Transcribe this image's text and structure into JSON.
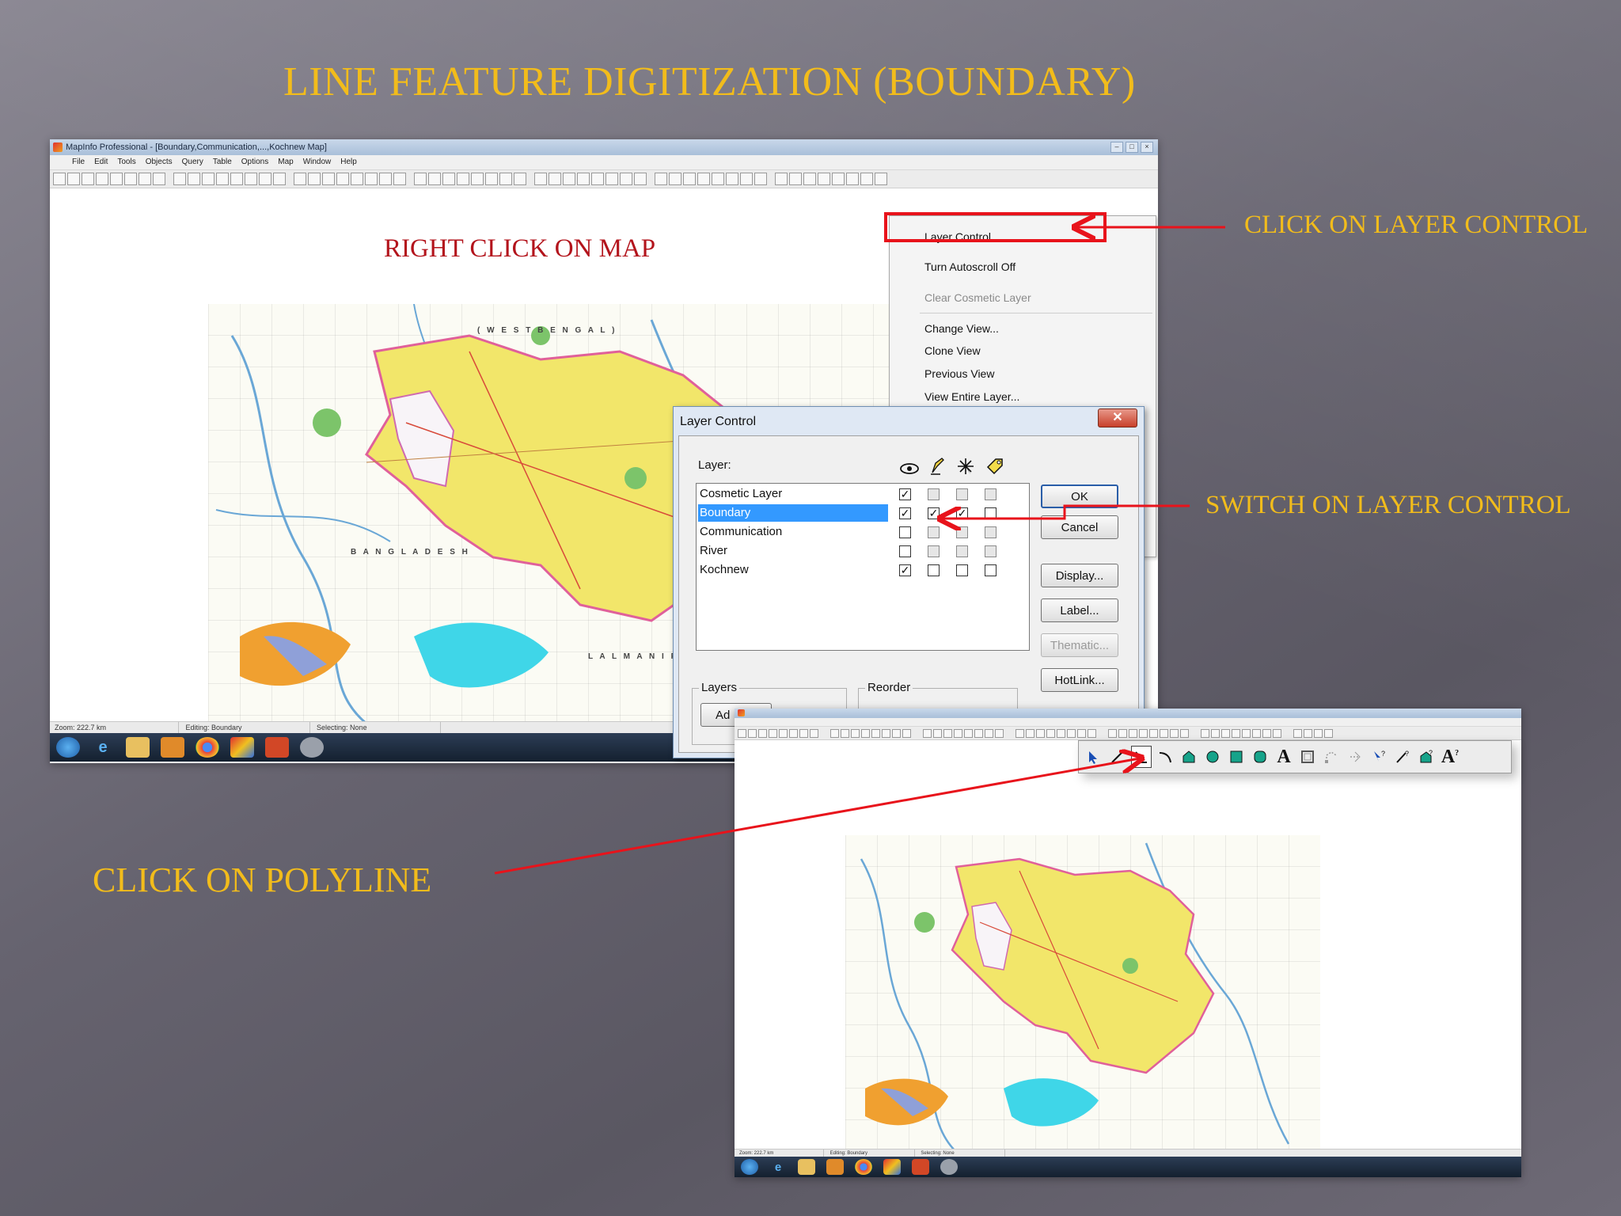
{
  "slide": {
    "title": "LINE FEATURE DIGITIZATION (BOUNDARY)"
  },
  "callouts": {
    "right_click": "RIGHT CLICK ON MAP",
    "click_layer_control": "CLICK ON LAYER CONTROL",
    "switch_layer_control": "SWITCH ON LAYER CONTROL",
    "click_polyline": "CLICK ON POLYLINE"
  },
  "colors": {
    "callout_text": "#f2bc1b",
    "map_note_text": "#b3141c",
    "annotation_red": "#e8131b",
    "selection_blue": "#3399ff"
  },
  "app_window": {
    "title": "MapInfo Professional - [Boundary,Communication,...,Kochnew Map]",
    "menus": [
      "File",
      "Edit",
      "Tools",
      "Objects",
      "Query",
      "Table",
      "Options",
      "Map",
      "Window",
      "Help"
    ],
    "status": {
      "zoom": "Zoom: 222.7 km",
      "editing": "Editing: Boundary",
      "selecting": "Selecting: None"
    },
    "map_labels": {
      "west_bengal": "( W E S T  B E N G A L )",
      "bangladesh": "B A N G L A D E S H",
      "lalmanirhat": "L A L M A N I R H A T"
    }
  },
  "context_menu": {
    "items": [
      {
        "label": "Layer Control...",
        "enabled": true
      },
      {
        "label": "Turn Autoscroll Off",
        "enabled": true
      },
      {
        "label": "Clear Cosmetic Layer",
        "enabled": false
      },
      {
        "label": "Change View...",
        "enabled": true
      },
      {
        "label": "Clone View",
        "enabled": true
      },
      {
        "label": "Previous View",
        "enabled": true
      },
      {
        "label": "View Entire Layer...",
        "enabled": true
      }
    ]
  },
  "layer_dialog": {
    "title": "Layer Control",
    "close_glyph": "✕",
    "layer_label": "Layer:",
    "layers": [
      {
        "name": "Cosmetic Layer",
        "visible": true,
        "editable": false,
        "selectable": false,
        "autolabel": false,
        "selected": false
      },
      {
        "name": "Boundary",
        "visible": true,
        "editable": true,
        "selectable": true,
        "autolabel": false,
        "selected": true
      },
      {
        "name": "Communication",
        "visible": false,
        "editable": false,
        "selectable": false,
        "autolabel": false,
        "selected": false
      },
      {
        "name": "River",
        "visible": false,
        "editable": false,
        "selectable": false,
        "autolabel": false,
        "selected": false
      },
      {
        "name": "Kochnew",
        "visible": true,
        "editable": false,
        "selectable": false,
        "autolabel": false,
        "selected": false
      }
    ],
    "buttons": {
      "ok": "OK",
      "cancel": "Cancel",
      "display": "Display...",
      "label": "Label...",
      "thematic": "Thematic...",
      "hotlink": "HotLink..."
    },
    "groups": {
      "layers": "Layers",
      "reorder": "Reorder",
      "add_partial": "Ad"
    }
  },
  "drawing_toolbar": {
    "tools": [
      "select-tool",
      "line-tool",
      "polyline-tool",
      "arc-tool",
      "polygon-tool",
      "ellipse-tool",
      "rectangle-tool",
      "rounded-rect-tool",
      "text-tool",
      "frame-tool",
      "reshape-tool",
      "add-node-tool",
      "symbol-style-tool",
      "line-style-tool",
      "region-style-tool",
      "text-style-tool"
    ],
    "active_tool": "polyline-tool",
    "text_glyph": "A",
    "text_style_glyph": "A"
  },
  "second_window": {
    "status": {
      "zoom": "Zoom: 222.7 km",
      "editing": "Editing: Boundary",
      "selecting": "Selecting: None"
    }
  }
}
